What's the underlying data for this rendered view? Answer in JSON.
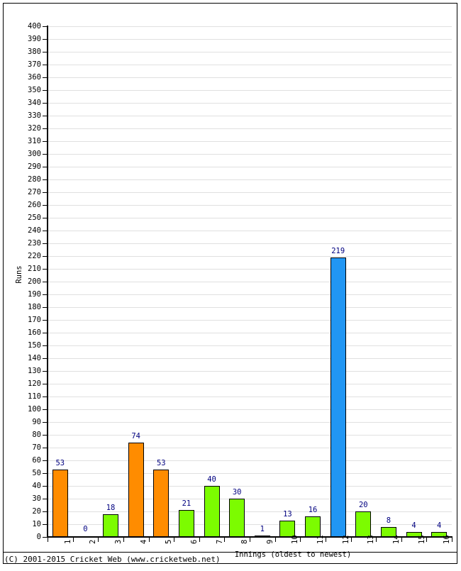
{
  "chart_data": {
    "type": "bar",
    "title": "",
    "xlabel": "Innings (oldest to newest)",
    "ylabel": "Runs",
    "categories": [
      "1",
      "2",
      "3",
      "4",
      "5",
      "6",
      "7",
      "8",
      "9",
      "10",
      "11",
      "12",
      "13",
      "14",
      "15",
      "16"
    ],
    "values": [
      53,
      0,
      18,
      74,
      53,
      21,
      40,
      30,
      1,
      13,
      16,
      219,
      20,
      8,
      4,
      4
    ],
    "bar_colors": [
      "#FF8C00",
      "#7CFC00",
      "#7CFC00",
      "#FF8C00",
      "#FF8C00",
      "#7CFC00",
      "#7CFC00",
      "#7CFC00",
      "#7CFC00",
      "#7CFC00",
      "#7CFC00",
      "#2196F3",
      "#7CFC00",
      "#7CFC00",
      "#7CFC00",
      "#7CFC00"
    ],
    "ylim": [
      0,
      400
    ],
    "ytick_step": 10,
    "yticks": [
      0,
      10,
      20,
      30,
      40,
      50,
      60,
      70,
      80,
      90,
      100,
      110,
      120,
      130,
      140,
      150,
      160,
      170,
      180,
      190,
      200,
      210,
      220,
      230,
      240,
      250,
      260,
      270,
      280,
      290,
      300,
      310,
      320,
      330,
      340,
      350,
      360,
      370,
      380,
      390,
      400
    ],
    "grid": true,
    "grid_color": "#e0e0e0",
    "legend": "none",
    "value_label_color": "#000080",
    "axis_color": "#000000",
    "background_color": "#ffffff"
  },
  "footer": {
    "copyright": "(C) 2001-2015 Cricket Web (www.cricketweb.net)"
  }
}
